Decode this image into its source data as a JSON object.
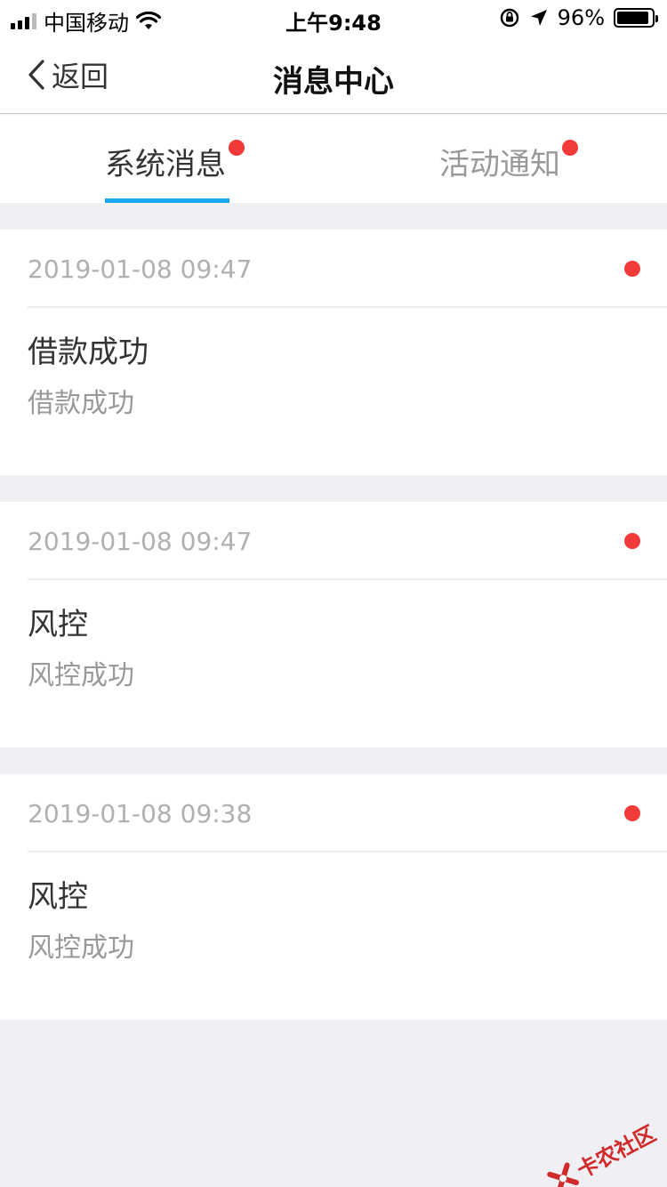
{
  "status_bar": {
    "carrier": "中国移动",
    "time": "上午9:48",
    "battery": "96%",
    "icons": [
      "signal-icon",
      "wifi-icon",
      "rotation-lock-icon",
      "location-icon",
      "battery-icon"
    ]
  },
  "nav": {
    "back_label": "返回",
    "title": "消息中心"
  },
  "tabs": [
    {
      "label": "系统消息",
      "active": true,
      "has_unread": true
    },
    {
      "label": "活动通知",
      "active": false,
      "has_unread": true
    }
  ],
  "messages": [
    {
      "time": "2019-01-08 09:47",
      "title": "借款成功",
      "body": "借款成功",
      "unread": true
    },
    {
      "time": "2019-01-08 09:47",
      "title": "风控",
      "body": "风控成功",
      "unread": true
    },
    {
      "time": "2019-01-08 09:38",
      "title": "风控",
      "body": "风控成功",
      "unread": true
    }
  ],
  "watermark": {
    "text": "卡农社区"
  },
  "colors": {
    "accent": "#1aa8ee",
    "unread_dot": "#f23a3a",
    "background": "#efeff4"
  }
}
